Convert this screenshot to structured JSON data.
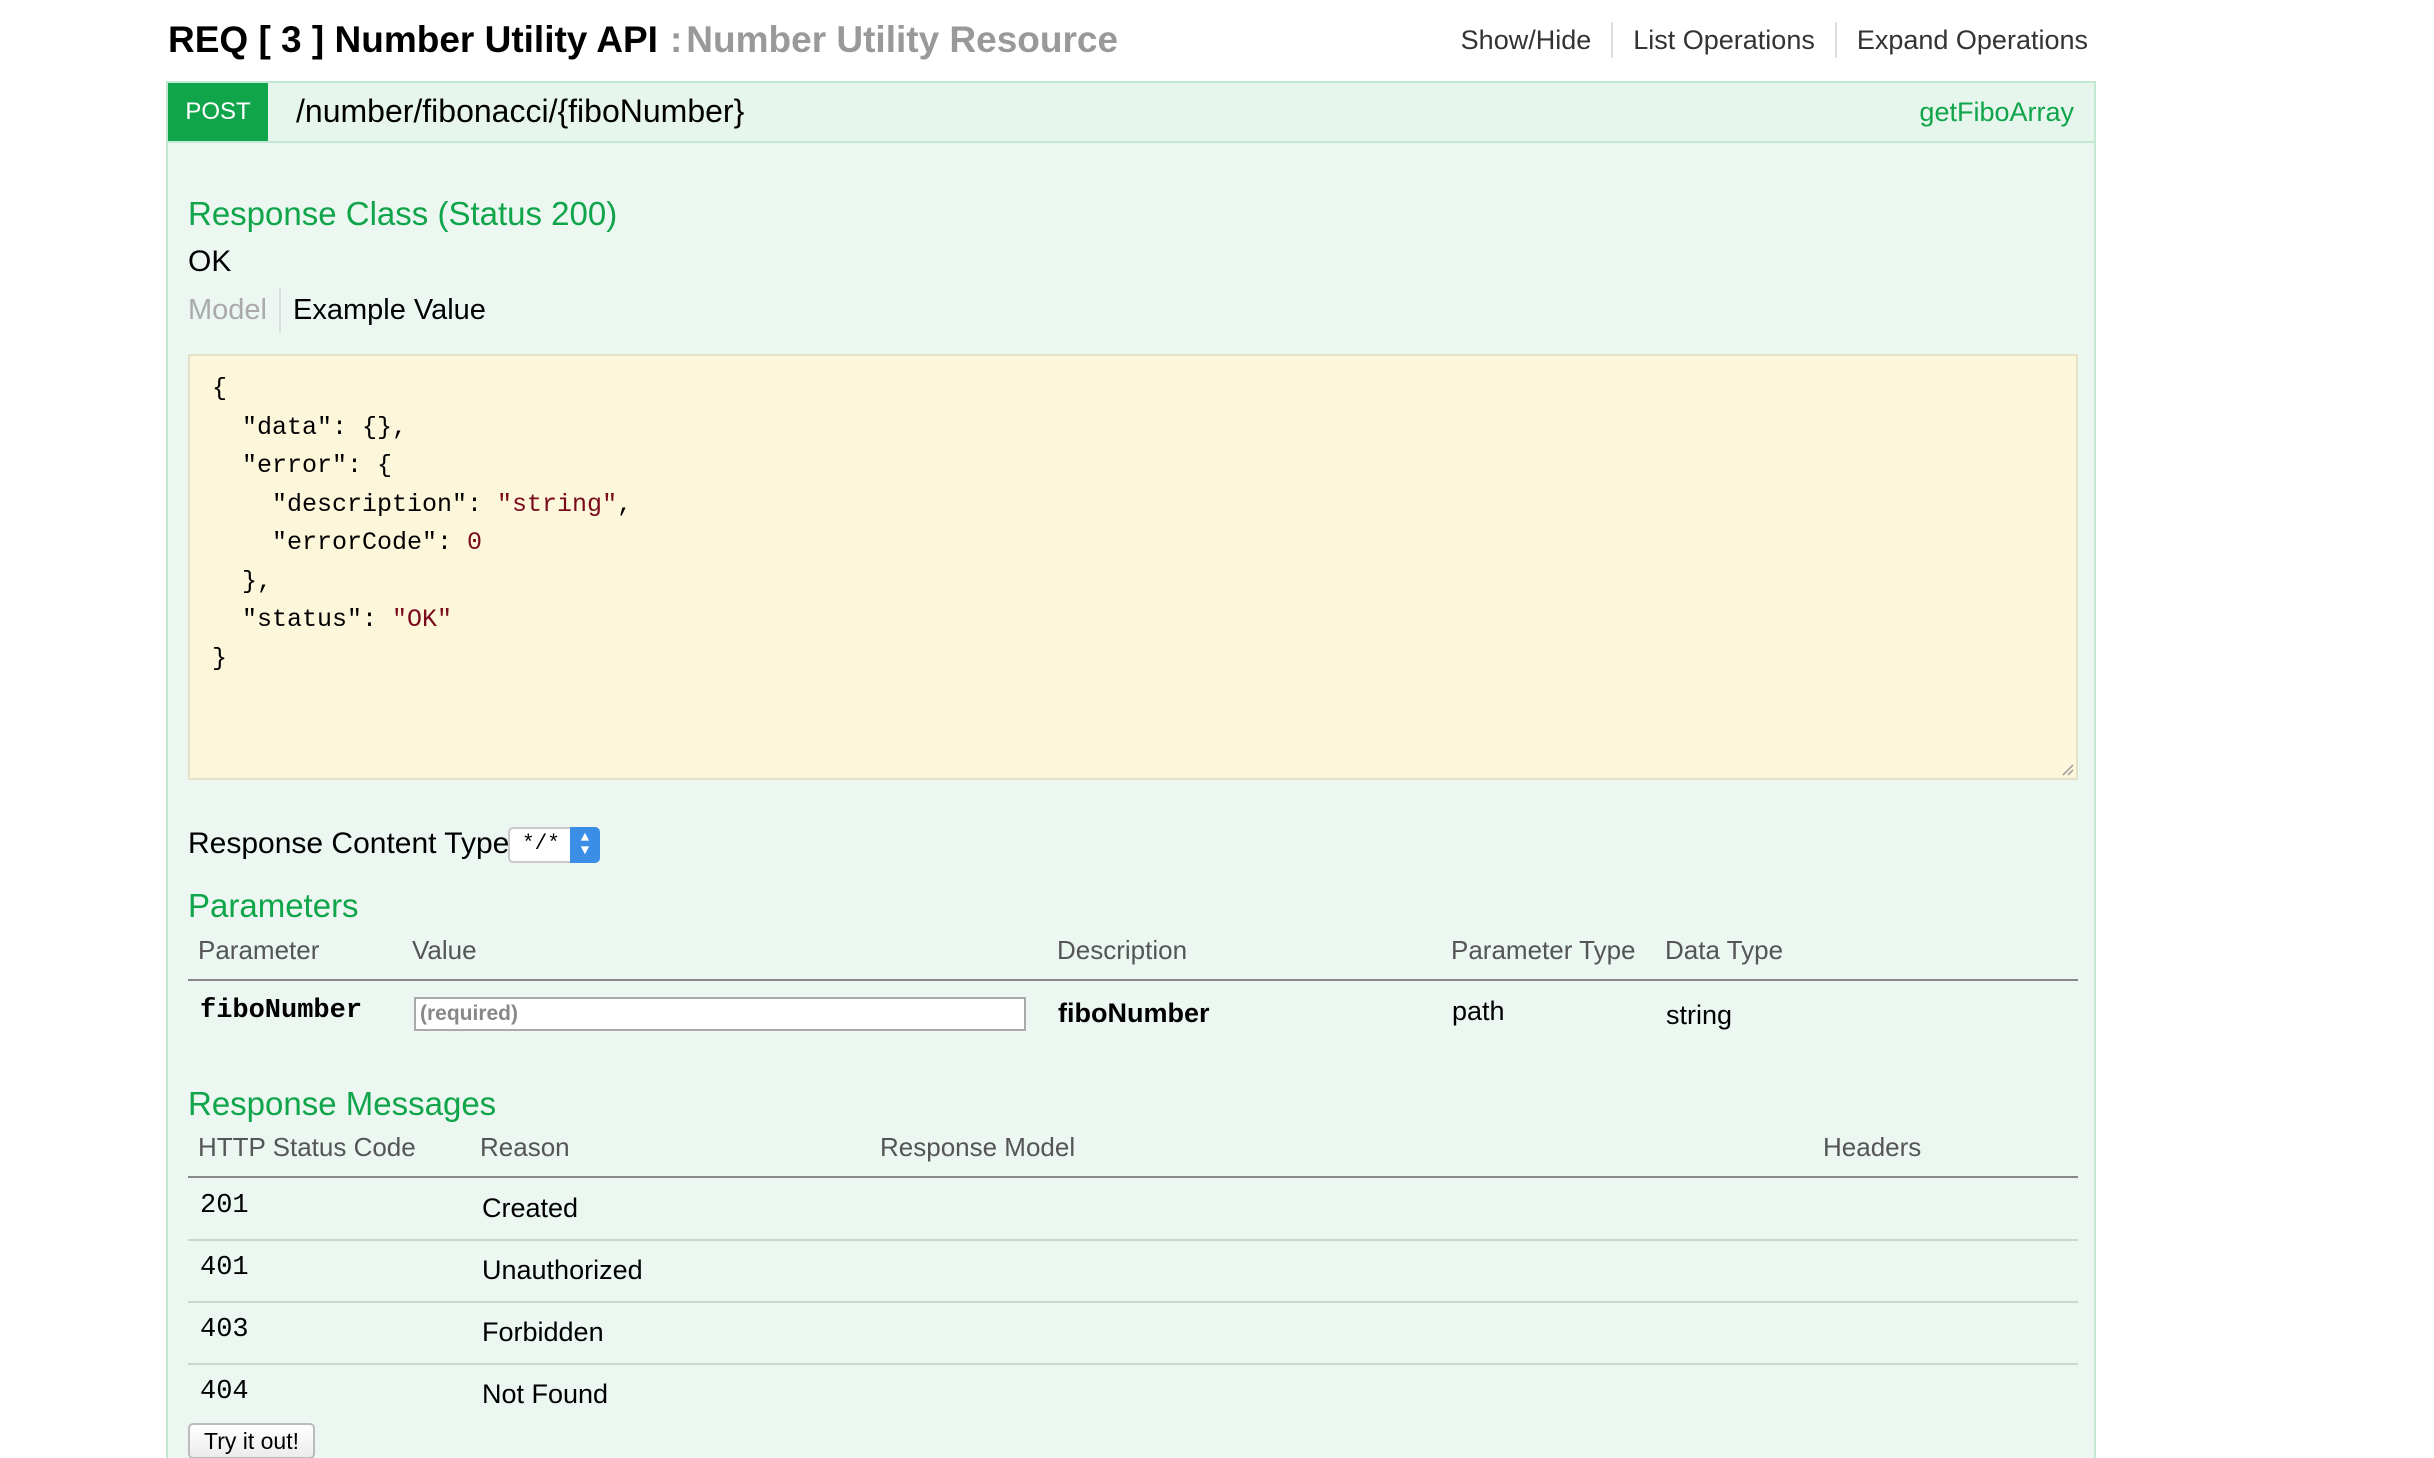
{
  "heading": {
    "api_name": "REQ [ 3 ] Number Utility API",
    "separator": ":",
    "resource_name": "Number Utility Resource"
  },
  "ops_links": {
    "show_hide": "Show/Hide",
    "list_operations": "List Operations",
    "expand_operations": "Expand Operations"
  },
  "operation": {
    "method": "POST",
    "path": "/number/fibonacci/{fiboNumber}",
    "nickname": "getFiboArray",
    "method_color": "#10a54a"
  },
  "response_class": {
    "title": "Response Class (Status 200)",
    "status_text": "OK",
    "tabs": [
      "Model",
      "Example Value"
    ],
    "active_tab": "Example Value",
    "example_lines": [
      "{",
      "  \"data\": {},",
      "  \"error\": {",
      "    \"description\": \"string\",",
      "    \"errorCode\": 0",
      "  },",
      "  \"status\": \"OK\"",
      "}"
    ]
  },
  "content_type": {
    "label": "Response Content Type",
    "selected": "*/*"
  },
  "parameters": {
    "title": "Parameters",
    "columns": [
      "Parameter",
      "Value",
      "Description",
      "Parameter Type",
      "Data Type"
    ],
    "rows": [
      {
        "parameter": "fiboNumber",
        "value_placeholder": "(required)",
        "description": "fiboNumber",
        "parameter_type": "path",
        "data_type": "string"
      }
    ]
  },
  "response_messages": {
    "title": "Response Messages",
    "columns": [
      "HTTP Status Code",
      "Reason",
      "Response Model",
      "Headers"
    ],
    "rows": [
      {
        "code": "201",
        "reason": "Created"
      },
      {
        "code": "401",
        "reason": "Unauthorized"
      },
      {
        "code": "403",
        "reason": "Forbidden"
      },
      {
        "code": "404",
        "reason": "Not Found"
      }
    ]
  },
  "try_button": "Try it out!"
}
